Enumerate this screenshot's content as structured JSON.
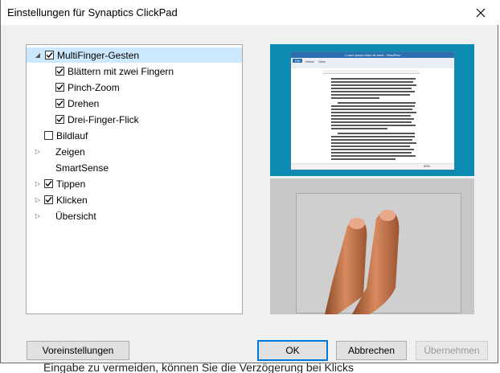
{
  "window": {
    "title": "Einstellungen für Synaptics ClickPad"
  },
  "tree": {
    "items": [
      {
        "label": "MultiFinger-Gesten",
        "checked": true,
        "expanded": true
      },
      {
        "label": "Blättern mit zwei Fingern",
        "checked": true
      },
      {
        "label": "Pinch-Zoom",
        "checked": true
      },
      {
        "label": "Drehen",
        "checked": true
      },
      {
        "label": "Drei-Finger-Flick",
        "checked": true
      },
      {
        "label": "Bildlauf",
        "checked": false
      },
      {
        "label": "Zeigen"
      },
      {
        "label": "SmartSense"
      },
      {
        "label": "Tippen",
        "checked": true
      },
      {
        "label": "Klicken",
        "checked": true
      },
      {
        "label": "Übersicht"
      }
    ],
    "help_label": "?"
  },
  "preview": {
    "doc_title": "Lorem ipsum dolor sit amet - WordPad",
    "tab_file": "File",
    "tab_home": "Home",
    "tab_view": "View",
    "zoom": "50%"
  },
  "buttons": {
    "defaults": "Voreinstellungen",
    "ok": "OK",
    "cancel": "Abbrechen",
    "apply": "Übernehmen"
  },
  "background": {
    "bottom_text": "Eingabe zu vermeiden, können Sie die Verzögerung bei Klicks"
  },
  "colors": {
    "selection": "#cce8ff",
    "accent": "#0078d7",
    "screen": "#0b8bb2"
  }
}
